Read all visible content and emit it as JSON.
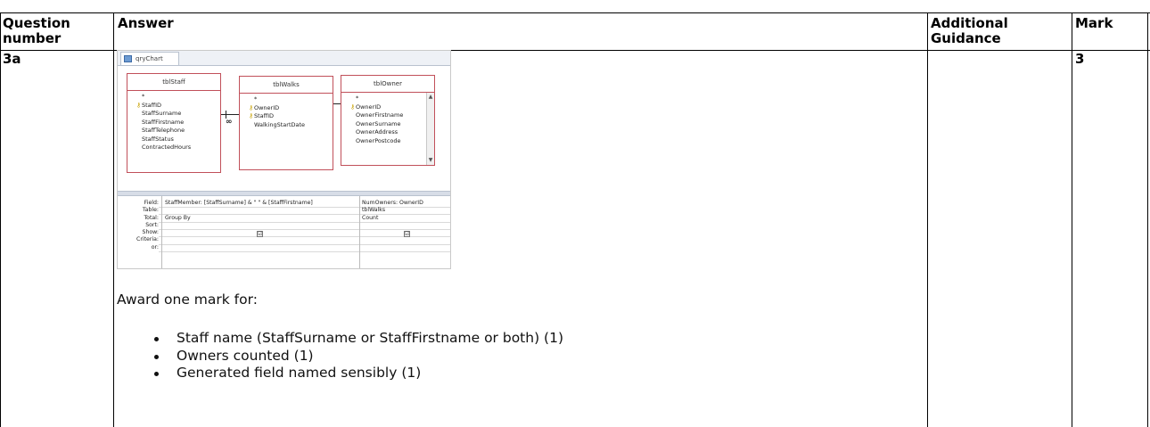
{
  "table": {
    "headers": {
      "question": "Question\nnumber",
      "answer": "Answer",
      "guidance": "Additional\nGuidance",
      "mark": "Mark"
    },
    "row": {
      "question": "3a",
      "mark": "3"
    }
  },
  "screenshot": {
    "tab": "qryChart",
    "tables": [
      {
        "name": "tblStaff",
        "fields": [
          "*",
          "StaffID",
          "StaffSurname",
          "StaffFirstname",
          "StaffTelephone",
          "StaffStatus",
          "ContractedHours"
        ],
        "keys": [
          false,
          true,
          false,
          false,
          false,
          false,
          false
        ]
      },
      {
        "name": "tblWalks",
        "fields": [
          "*",
          "OwnerID",
          "StaffID",
          "WalkingStartDate"
        ],
        "keys": [
          false,
          true,
          true,
          false
        ]
      },
      {
        "name": "tblOwner",
        "fields": [
          "*",
          "OwnerID",
          "OwnerFirstname",
          "OwnerSurname",
          "OwnerAddress",
          "OwnerPostcode"
        ],
        "keys": [
          false,
          true,
          false,
          false,
          false,
          false
        ]
      }
    ],
    "grid": {
      "labels": [
        "Field:",
        "Table:",
        "Total:",
        "Sort:",
        "Show:",
        "Criteria:",
        "or:"
      ],
      "col1": {
        "field": "StaffMember: [StaffSurname] & \" \" & [StaffFirstname]",
        "table": "",
        "total": "Group By",
        "show": "☑"
      },
      "col2": {
        "field": "NumOwners: OwnerID",
        "table": "tblWalks",
        "total": "Count",
        "show": "☑"
      }
    }
  },
  "answer": {
    "award": "Award one mark for:",
    "bullets": [
      "Staff name (StaffSurname or StaffFirstname or both) (1)",
      "Owners counted (1)",
      "Generated field named sensibly (1)"
    ]
  }
}
